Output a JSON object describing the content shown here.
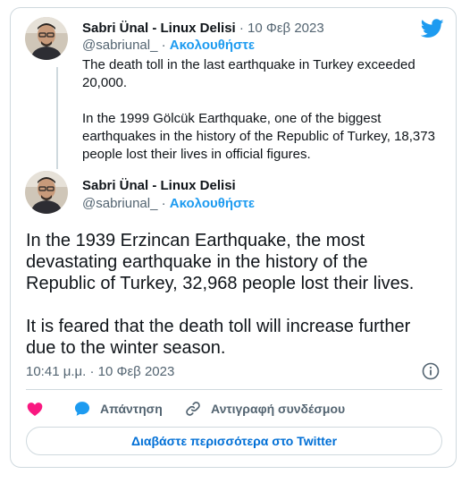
{
  "tweets": [
    {
      "author_name": "Sabri Ünal - Linux Delisi",
      "date": "· 10 Φεβ 2023",
      "handle": "@sabriunal_",
      "follow_sep": " · ",
      "follow_label": "Ακολουθήστε",
      "paragraphs": [
        "The death toll in the last earthquake in Turkey exceeded 20,000.",
        "In the 1999 Gölcük Earthquake, one of the biggest earthquakes in the history of the Republic of Turkey, 18,373 people lost their lives in official figures."
      ]
    },
    {
      "author_name": "Sabri Ünal - Linux Delisi",
      "handle": "@sabriunal_",
      "follow_sep": " · ",
      "follow_label": "Ακολουθήστε",
      "paragraphs": [
        "In the 1939 Erzincan Earthquake, the most devastating earthquake in the history of the Republic of Turkey, 32,968 people lost their lives.",
        "It is feared that the death toll will increase further due to the winter season."
      ],
      "timestamp": "10:41 μ.μ. · 10 Φεβ 2023"
    }
  ],
  "actions": {
    "reply_label": "Απάντηση",
    "copy_link_label": "Αντιγραφή συνδέσμου"
  },
  "read_more_label": "Διαβάστε περισσότερα στο Twitter",
  "colors": {
    "accent": "#1d9bf0",
    "like": "#f91880",
    "border": "#cfd9de",
    "muted": "#536471"
  },
  "icons": [
    "twitter-bird-icon",
    "info-icon",
    "heart-icon",
    "reply-bubble-icon",
    "link-icon"
  ]
}
